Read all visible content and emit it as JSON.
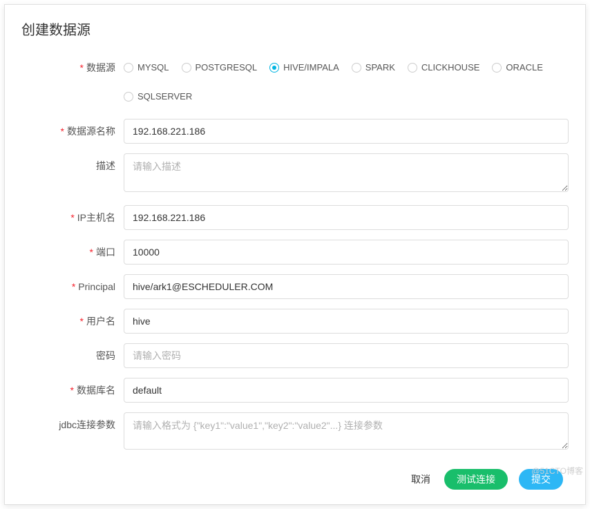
{
  "modal": {
    "title": "创建数据源"
  },
  "fields": {
    "dataSourceType": {
      "label": "数据源"
    },
    "dataSourceName": {
      "label": "数据源名称",
      "value": "192.168.221.186"
    },
    "description": {
      "label": "描述",
      "placeholder": "请输入描述",
      "value": ""
    },
    "ipHost": {
      "label": "IP主机名",
      "value": "192.168.221.186"
    },
    "port": {
      "label": "端口",
      "value": "10000"
    },
    "principal": {
      "label": "Principal",
      "value": "hive/ark1@ESCHEDULER.COM"
    },
    "username": {
      "label": "用户名",
      "value": "hive"
    },
    "password": {
      "label": "密码",
      "placeholder": "请输入密码",
      "value": ""
    },
    "database": {
      "label": "数据库名",
      "value": "default"
    },
    "jdbcParams": {
      "label": "jdbc连接参数",
      "placeholder": "请输入格式为 {\"key1\":\"value1\",\"key2\":\"value2\"...} 连接参数",
      "value": ""
    }
  },
  "radioOptions": {
    "mysql": "MYSQL",
    "postgresql": "POSTGRESQL",
    "hiveImpala": "HIVE/IMPALA",
    "spark": "SPARK",
    "clickhouse": "CLICKHOUSE",
    "oracle": "ORACLE",
    "sqlserver": "SQLSERVER"
  },
  "selectedRadio": "hiveImpala",
  "footer": {
    "cancel": "取消",
    "testConnection": "测试连接",
    "submit": "提交"
  },
  "watermark": "@51CTO博客"
}
